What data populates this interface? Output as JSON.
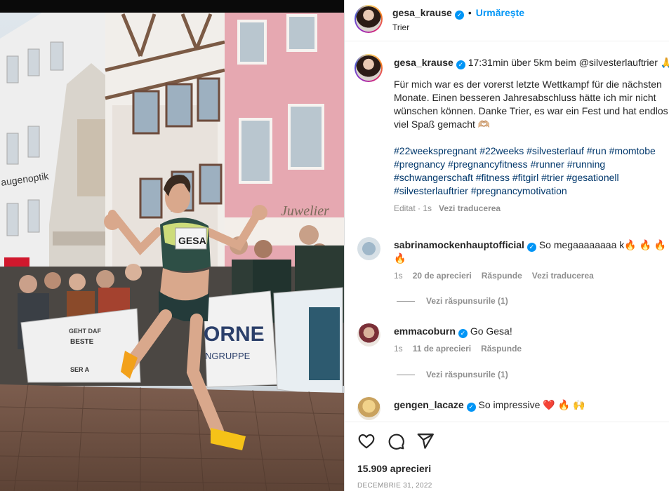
{
  "post": {
    "author": "gesa_krause",
    "follow_label": "Urmărește",
    "location": "Trier",
    "photo_banner_text": [
      "Juwelier",
      "augenoptik",
      "GESA",
      "ORNE",
      "NGRUPPE",
      "BESTE",
      "GEHT DAF",
      "SER A"
    ]
  },
  "caption": {
    "author": "gesa_krause",
    "first_line": "17:31min über 5km beim @silvesterlauftrier 🙏",
    "body": "Für mich war es der vorerst letzte Wettkampf für die nächsten\nMonate. Einen besseren Jahresabschluss hätte ich mir nicht\nwünschen können. Danke Trier, es war ein Fest und hat endlos\nviel Spaß gemacht 🫶🏼",
    "hashtags": "#22weekspregnant #22weeks #silvesterlauf #run #momtobe\n#pregnancy #pregnancyfitness #runner #running\n#schwangerschaft #fitness #fitgirl #trier #gesationell\n#silvesterlauftrier #pregnancymotivation",
    "edited": "Editat · 1s",
    "translate": "Vezi traducerea"
  },
  "comments": [
    {
      "user": "sabrinamockenhauptofficial",
      "text": "So megaaaaaaaa k🔥 🔥 🔥 🔥",
      "text2": "🔥",
      "time": "1s",
      "likes": "20 de aprecieri",
      "reply": "Răspunde",
      "translate": "Vezi traducerea",
      "replies": "Vezi răspunsurile (1)"
    },
    {
      "user": "emmacoburn",
      "text": "Go Gesa!",
      "time": "1s",
      "likes": "11 de aprecieri",
      "reply": "Răspunde",
      "replies": "Vezi răspunsurile (1)"
    },
    {
      "user": "gengen_lacaze",
      "text": "So impressive ❤️ 🔥 🙌"
    }
  ],
  "footer": {
    "likes": "15.909 aprecieri",
    "date": "DECEMBRIE 31, 2022"
  },
  "icons": {
    "like": "heart-icon",
    "comment": "comment-icon",
    "share": "share-icon",
    "verified": "verified-badge-icon"
  },
  "colors": {
    "link": "#00376b",
    "accent": "#0095f6",
    "muted": "#8e8e8e"
  }
}
